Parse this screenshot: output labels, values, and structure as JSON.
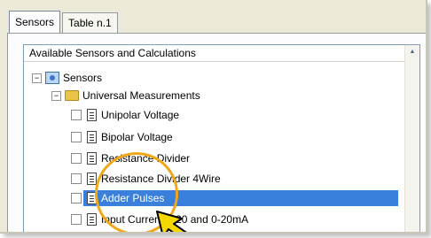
{
  "tabs": [
    "Sensors",
    "Table n.1"
  ],
  "list_header": "Available Sensors and Calculations",
  "tree": {
    "root": {
      "label": "Sensors",
      "expander": "−"
    },
    "group": {
      "label": "Universal Measurements",
      "expander": "−"
    },
    "items": [
      {
        "label": "Unipolar Voltage",
        "selected": false
      },
      {
        "label": "Bipolar Voltage",
        "selected": false
      },
      {
        "label": "Resistance Divider",
        "selected": false
      },
      {
        "label": "Resistance Divider 4Wire",
        "selected": false
      },
      {
        "label": "Adder Pulses",
        "selected": true
      },
      {
        "label": "Input Current 4-20 and 0-20mA",
        "selected": false
      }
    ]
  },
  "colors": {
    "selection": "#3a7fdc",
    "highlight_circle": "#f0a818",
    "cursor_fill": "#f5d800"
  }
}
